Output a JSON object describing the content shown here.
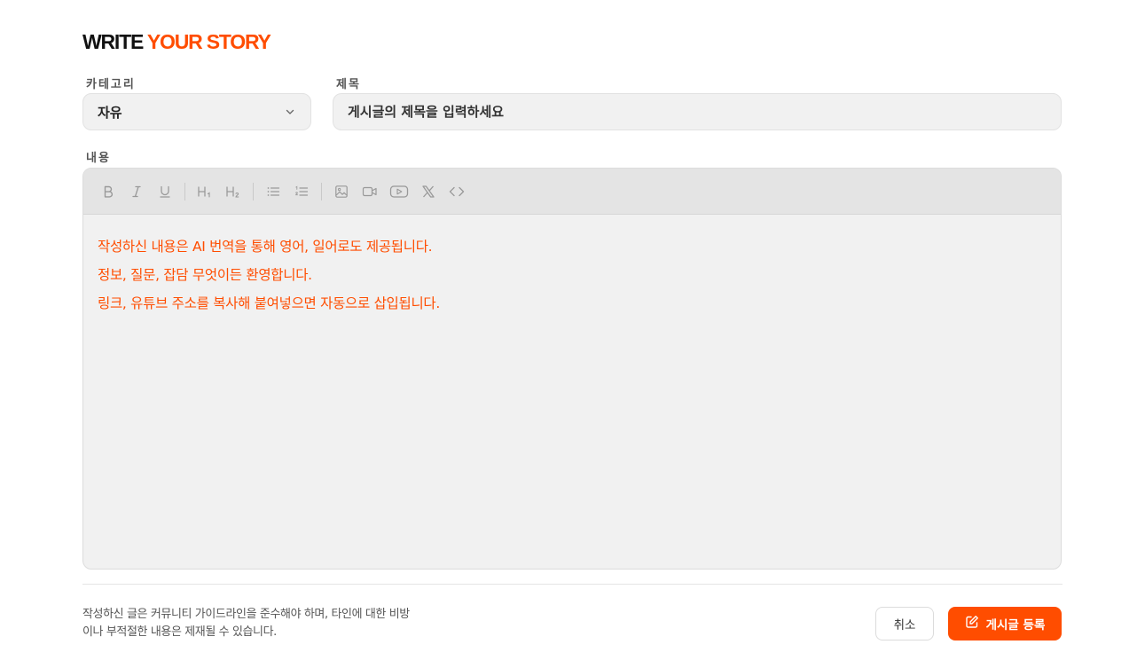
{
  "heading": {
    "plain": "WRITE",
    "accent": "YOUR STORY"
  },
  "form": {
    "category_label": "카테고리",
    "category_value": "자유",
    "title_label": "제목",
    "title_placeholder": "게시글의 제목을 입력하세요",
    "content_label": "내용"
  },
  "editor": {
    "toolbar": [
      "bold-icon",
      "italic-icon",
      "underline-icon",
      "heading-1-icon",
      "heading-2-icon",
      "bullet-list-icon",
      "ordered-list-icon",
      "image-icon",
      "video-icon",
      "youtube-icon",
      "x-twitter-icon",
      "code-icon"
    ],
    "placeholder_lines": [
      "작성하신 내용은 AI 번역을 통해 영어, 일어로도 제공됩니다.",
      "정보, 질문, 잡담 무엇이든 환영합니다.",
      "링크, 유튜브 주소를 복사해 붙여넣으면 자동으로 삽입됩니다."
    ]
  },
  "footer": {
    "notice_line1": "작성하신 글은 커뮤니티 가이드라인을 준수해야 하며, 타인에 대한 비방",
    "notice_line2": "이나 부적절한 내용은 제재될 수 있습니다.",
    "cancel_label": "취소",
    "submit_label": "게시글 등록"
  },
  "colors": {
    "accent": "#ff4d00",
    "field_bg": "#f1f1f1",
    "toolbar_bg": "#e4e4e4"
  }
}
